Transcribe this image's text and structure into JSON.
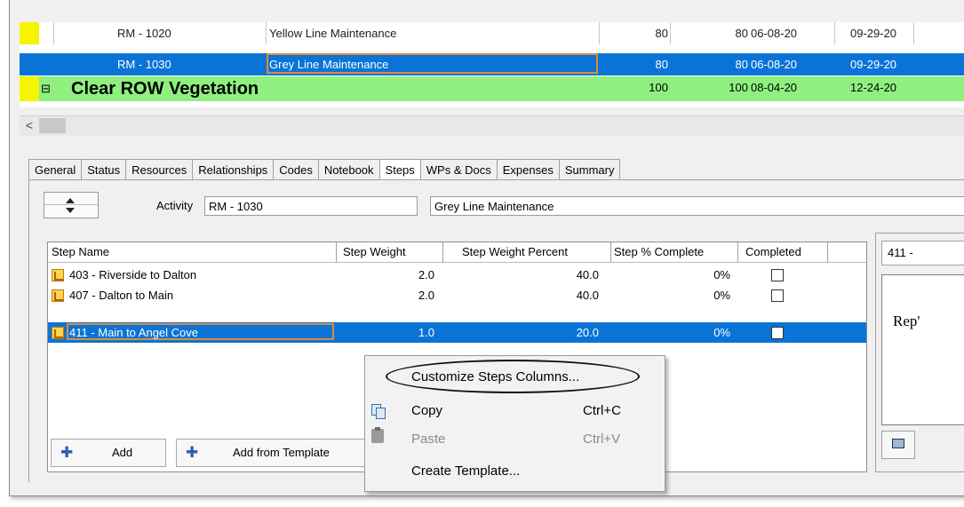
{
  "activities": [
    {
      "id": "RM - 1020",
      "name": "Yellow Line Maintenance",
      "v1": "80",
      "v2": "80",
      "start": "06-08-20",
      "finish": "09-29-20"
    },
    {
      "id": "RM - 1030",
      "name": "Grey Line Maintenance",
      "v1": "80",
      "v2": "80",
      "start": "06-08-20",
      "finish": "09-29-20"
    }
  ],
  "wbs_row": {
    "toggle": "⊟",
    "name": "Clear ROW Vegetation",
    "v1": "100",
    "v2": "100",
    "start": "08-04-20",
    "finish": "12-24-20"
  },
  "scroll_left": "<",
  "tabs": [
    "General",
    "Status",
    "Resources",
    "Relationships",
    "Codes",
    "Notebook",
    "Steps",
    "WPs & Docs",
    "Expenses",
    "Summary"
  ],
  "activity_label": "Activity",
  "activity_id": "RM - 1030",
  "activity_name": "Grey Line Maintenance",
  "steps_grid": {
    "headers": [
      "Step Name",
      "Step Weight",
      "Step Weight Percent",
      "Step % Complete",
      "Completed"
    ],
    "rows": [
      {
        "name": "403 - Riverside to Dalton",
        "weight": "2.0",
        "percent": "40.0",
        "complete": "0%"
      },
      {
        "name": "407 - Dalton to Main",
        "weight": "2.0",
        "percent": "40.0",
        "complete": "0%"
      },
      {
        "name": "411 - Main to Angel Cove",
        "weight": "1.0",
        "percent": "20.0",
        "complete": "0%"
      }
    ]
  },
  "buttons": {
    "add": "Add",
    "add_template": "Add from Template"
  },
  "right_pane": {
    "head": "411 - ",
    "body": "Rep'"
  },
  "context_menu": {
    "customize": "Customize Steps Columns...",
    "copy": "Copy",
    "copy_key": "Ctrl+C",
    "paste": "Paste",
    "paste_key": "Ctrl+V",
    "create_template": "Create Template..."
  },
  "colors": {
    "selection": "#0a74d6",
    "wbs_green": "#8ff07f",
    "marker_yellow": "#f5f500",
    "outline_orange": "#e08a3a"
  }
}
